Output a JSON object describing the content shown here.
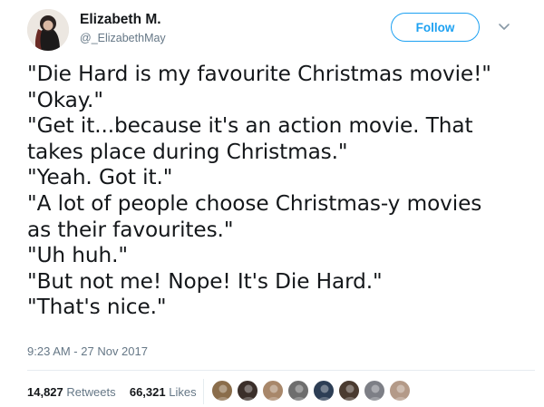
{
  "user": {
    "name": "Elizabeth M.",
    "handle": "@_ElizabethMay"
  },
  "follow_button": {
    "label": "Follow"
  },
  "tweet": {
    "lines": [
      "\"Die Hard is my favourite Christmas movie!\"",
      "\"Okay.\"",
      "\"Get it...because it's an action movie. That",
      "takes place during Christmas.\"",
      "\"Yeah. Got it.\"",
      "\"A lot of people choose Christmas-y movies",
      "as their favourites.\"",
      "\"Uh huh.\"",
      "\"But not me! Nope! It's Die Hard.\"",
      "\"That's nice.\""
    ],
    "timestamp": "9:23 AM - 27 Nov 2017"
  },
  "stats": {
    "retweets": {
      "count": "14,827",
      "label": "Retweets"
    },
    "likes": {
      "count": "66,321",
      "label": "Likes"
    }
  },
  "likers": [
    {
      "icon": "liker-avatar-icon",
      "color": "#8a6d4b"
    },
    {
      "icon": "liker-avatar-icon",
      "color": "#3b2f2a"
    },
    {
      "icon": "liker-avatar-icon",
      "color": "#a8876a"
    },
    {
      "icon": "liker-avatar-icon",
      "color": "#6e6e6e"
    },
    {
      "icon": "liker-avatar-icon",
      "color": "#2d3e55"
    },
    {
      "icon": "liker-avatar-icon",
      "color": "#4a3b30"
    },
    {
      "icon": "liker-avatar-icon",
      "color": "#7d7f86"
    },
    {
      "icon": "liker-avatar-icon",
      "color": "#b49a88"
    }
  ],
  "colors": {
    "accent": "#1da1f2",
    "text": "#14171a",
    "secondary_text": "#657786",
    "divider": "#e6ecf0"
  }
}
